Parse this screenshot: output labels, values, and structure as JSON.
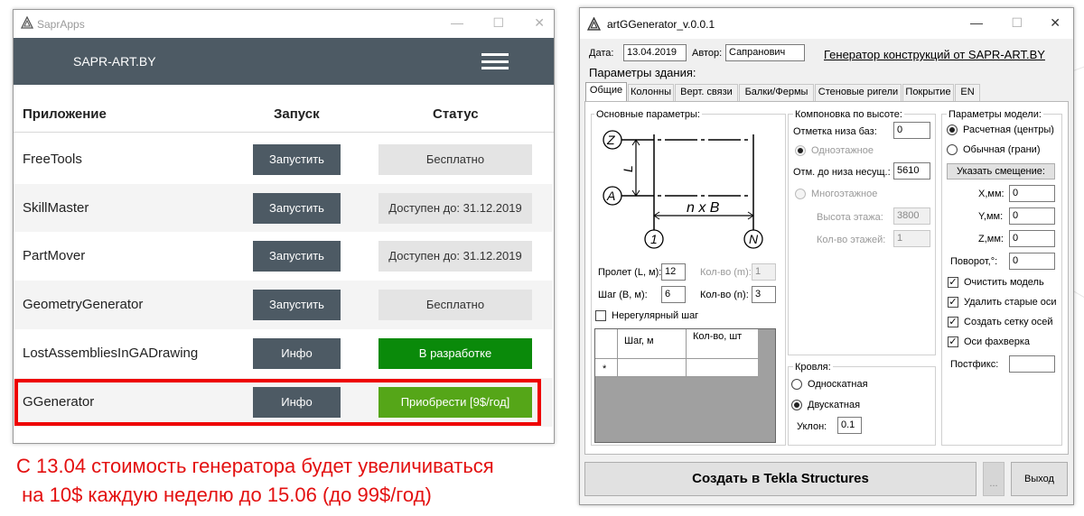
{
  "left_app": {
    "title": "SaprApps",
    "brand": "SAPR-ART.BY",
    "columns": {
      "app": "Приложение",
      "launch": "Запуск",
      "status": "Статус"
    },
    "rows": [
      {
        "name": "FreeTools",
        "action": "Запустить",
        "status": "Бесплатно",
        "style": "gray"
      },
      {
        "name": "SkillMaster",
        "action": "Запустить",
        "status": "Доступен до: 31.12.2019",
        "style": "gray"
      },
      {
        "name": "PartMover",
        "action": "Запустить",
        "status": "Доступен до: 31.12.2019",
        "style": "gray"
      },
      {
        "name": "GeometryGenerator",
        "action": "Запустить",
        "status": "Бесплатно",
        "style": "gray"
      },
      {
        "name": "LostAssembliesInGADrawing",
        "action": "Инфо",
        "status": "В разработке",
        "style": "green"
      },
      {
        "name": "GGenerator",
        "action": "Инфо",
        "status": "Приобрести [9$/год]",
        "style": "lgreen"
      }
    ]
  },
  "promo": {
    "line1": "С 13.04 стоимость генератора будет увеличиваться",
    "line2": " на 10$ каждую неделю до 15.06 (до 99$/год)"
  },
  "right_app": {
    "title": "artGGenerator_v.0.0.1",
    "date_label": "Дата:",
    "date_value": "13.04.2019",
    "author_label": "Автор:",
    "author_value": "Сапранович",
    "link": "Генератор конструкций от SAPR-ART.BY",
    "building_params": "Параметры здания:",
    "tabs": [
      "Общие",
      "Колонны",
      "Верт. связи",
      "Балки/Фермы",
      "Стеновые ригели",
      "Покрытие",
      "EN"
    ],
    "basic": {
      "title": "Основные параметры:",
      "axis_z": "Z",
      "axis_a": "A",
      "axis_1": "1",
      "axis_n": "N",
      "l_label": "L",
      "nxb": "n x B",
      "span_label": "Пролет (L, м):",
      "span_value": "12",
      "count_m_label": "Кол-во (m):",
      "count_m_value": "1",
      "step_label": "Шаг (B, м):",
      "step_value": "6",
      "count_n_label": "Кол-во (n):",
      "count_n_value": "3",
      "irregular_label": "Нерегулярный шаг",
      "grid_col1": "Шаг, м",
      "grid_col2": "Кол-во, шт",
      "grid_marker": "*"
    },
    "height": {
      "title": "Компоновка по высоте:",
      "base_label": "Отметка низа баз:",
      "base_value": "0",
      "one_storey": "Одноэтажное",
      "bottom_label": "Отм. до низа несущ.:",
      "bottom_value": "5610",
      "multi_storey": "Многоэтажное",
      "floor_h_label": "Высота этажа:",
      "floor_h_value": "3800",
      "floors_label": "Кол-во этажей:",
      "floors_value": "1"
    },
    "roof": {
      "title": "Кровля:",
      "single": "Односкатная",
      "double": "Двускатная",
      "slope_label": "Уклон:",
      "slope_value": "0.1"
    },
    "model": {
      "title": "Параметры модели:",
      "calc": "Расчетная (центры)",
      "normal": "Обычная (грани)",
      "offset_button": "Указать смещение:",
      "x_label": "X,мм:",
      "x_value": "0",
      "y_label": "Y,мм:",
      "y_value": "0",
      "z_label": "Z,мм:",
      "z_value": "0",
      "rot_label": "Поворот,°:",
      "rot_value": "0",
      "clear_model": "Очистить модель",
      "delete_axes": "Удалить старые оси",
      "create_grid": "Создать сетку осей",
      "axes_fachwerk": "Оси фахверка",
      "postfix_label": "Постфикс:",
      "postfix_value": ""
    },
    "create_button": "Создать в Tekla Structures",
    "small_button": "...",
    "exit_button": "Выход"
  }
}
